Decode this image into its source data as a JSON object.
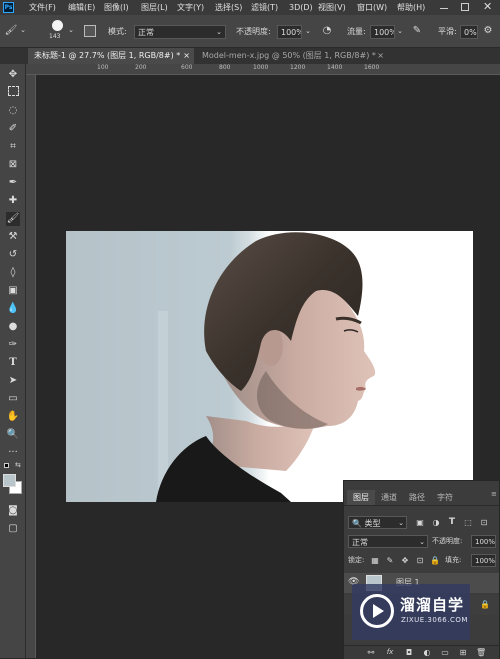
{
  "app": {
    "logo": "Ps"
  },
  "menubar": {
    "items": [
      "文件(F)",
      "编辑(E)",
      "图像(I)",
      "图层(L)",
      "文字(Y)",
      "选择(S)",
      "滤镜(T)",
      "3D(D)",
      "视图(V)",
      "窗口(W)",
      "帮助(H)"
    ]
  },
  "options": {
    "brush_size": "143",
    "mode_label": "模式:",
    "mode_value": "正常",
    "opacity_label": "不透明度:",
    "opacity_value": "100%",
    "flow_label": "流量:",
    "flow_value": "100%",
    "smoothing_label": "平滑:",
    "smoothing_value": "0%"
  },
  "tabs": [
    {
      "label": "未标题-1 @ 27.7% (图层 1, RGB/8#) *",
      "close": "×"
    },
    {
      "label": "Model-men-x.jpg @ 50% (图层 1, RGB/8#) *",
      "close": "×"
    }
  ],
  "ruler": {
    "ticks": [
      "100",
      "200",
      "600",
      "800",
      "1000",
      "1200",
      "1400",
      "1600"
    ]
  },
  "layers_panel": {
    "tabs": [
      "图层",
      "通道",
      "路径",
      "字符"
    ],
    "filter_kind": "类型",
    "blend_mode": "正常",
    "opacity_label": "不透明度:",
    "opacity_value": "100%",
    "lock_label": "锁定:",
    "fill_label": "填充:",
    "fill_value": "100%",
    "layer_name": "图层 1",
    "bottom_icons": [
      "link-icon",
      "fx-icon",
      "mask-icon",
      "adjustment-icon",
      "group-icon",
      "new-layer-icon",
      "trash-icon"
    ]
  },
  "watermark": {
    "title": "溜溜自学",
    "url": "ZIXUE.3066.COM"
  },
  "colors": {
    "app_bg": "#282828",
    "toolbar": "#454545",
    "canvas_bg_left": "#b7c6cc",
    "canvas_bg_right": "#ffffff",
    "accent": "#31a8ff"
  }
}
